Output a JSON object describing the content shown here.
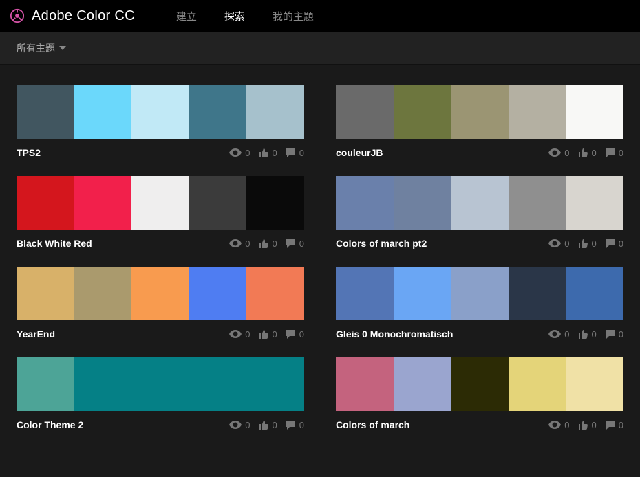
{
  "header": {
    "app_title": "Adobe Color CC",
    "nav": [
      "建立",
      "探索",
      "我的主題"
    ],
    "active_nav_index": 1
  },
  "subbar": {
    "filter_label": "所有主題"
  },
  "stat_labels": {
    "views": "0",
    "likes": "0",
    "comments": "0"
  },
  "themes": [
    {
      "name": "TPS2",
      "colors": [
        "#415660",
        "#6bd8fb",
        "#c1e9f6",
        "#3f768a",
        "#a6c1cc"
      ],
      "views": "0",
      "likes": "0",
      "comments": "0"
    },
    {
      "name": "couleurJB",
      "colors": [
        "#6a6a6a",
        "#6d763e",
        "#9b9573",
        "#b4b0a2",
        "#f8f8f6"
      ],
      "views": "0",
      "likes": "0",
      "comments": "0"
    },
    {
      "name": "Black White Red",
      "colors": [
        "#d4161d",
        "#f2204b",
        "#efeeee",
        "#3b3b3b",
        "#0a0a0a"
      ],
      "views": "0",
      "likes": "0",
      "comments": "0"
    },
    {
      "name": "Colors of march pt2",
      "colors": [
        "#6a80ab",
        "#6f81a0",
        "#b8c4d2",
        "#8f8f8f",
        "#d8d5cf"
      ],
      "views": "0",
      "likes": "0",
      "comments": "0"
    },
    {
      "name": "YearEnd",
      "colors": [
        "#d8b169",
        "#aa9a6d",
        "#f89b4f",
        "#4f7df2",
        "#f27a55"
      ],
      "views": "0",
      "likes": "0",
      "comments": "0"
    },
    {
      "name": "Gleis 0 Monochromatisch",
      "colors": [
        "#5375b5",
        "#6aa6f4",
        "#8aa0c9",
        "#2a3648",
        "#3d6aad"
      ],
      "views": "0",
      "likes": "0",
      "comments": "0"
    },
    {
      "name": "Color Theme 2",
      "colors": [
        "#4da497",
        "#058086",
        "#058086",
        "#058086",
        "#058086"
      ],
      "flex": [
        1,
        4,
        0,
        0,
        0
      ],
      "views": "0",
      "likes": "0",
      "comments": "0"
    },
    {
      "name": "Colors of march",
      "colors": [
        "#c4637e",
        "#9aa5cf",
        "#2c2b05",
        "#e4d479",
        "#f0e1a6"
      ],
      "views": "0",
      "likes": "0",
      "comments": "0"
    }
  ]
}
